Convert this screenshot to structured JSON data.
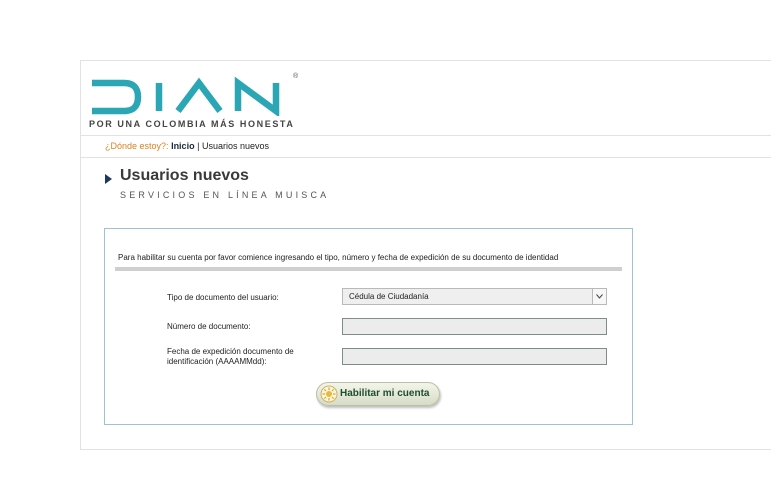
{
  "header": {
    "logo_text": "DIAN",
    "tagline": "POR UNA COLOMBIA MÁS HONESTA",
    "registered_mark": "®"
  },
  "breadcrumb": {
    "where_label": "¿Dónde estoy?:",
    "home": "Inicio",
    "separator": "|",
    "current": "Usuarios nuevos"
  },
  "page": {
    "title": "Usuarios nuevos",
    "subtitle": "SERVICIOS EN LÍNEA MUISCA"
  },
  "form": {
    "intro": "Para habilitar su cuenta por favor comience ingresando el tipo, número y fecha de expedición de su documento de identidad",
    "doc_type_label": "Tipo de documento del usuario:",
    "doc_type_value": "Cédula de Ciudadanía",
    "doc_number_label": "Número de documento:",
    "doc_number_value": "",
    "issue_date_label_line1": "Fecha de expedición documento de",
    "issue_date_label_line2": "identificación (AAAAMMdd):",
    "issue_date_value": "",
    "submit_label": "Habilitar mi cuenta"
  },
  "colors": {
    "logo_teal": "#2aa6b5",
    "breadcrumb_accent": "#d9831f",
    "title_arrow": "#1d3a5c",
    "button_text": "#1f4d2e"
  }
}
